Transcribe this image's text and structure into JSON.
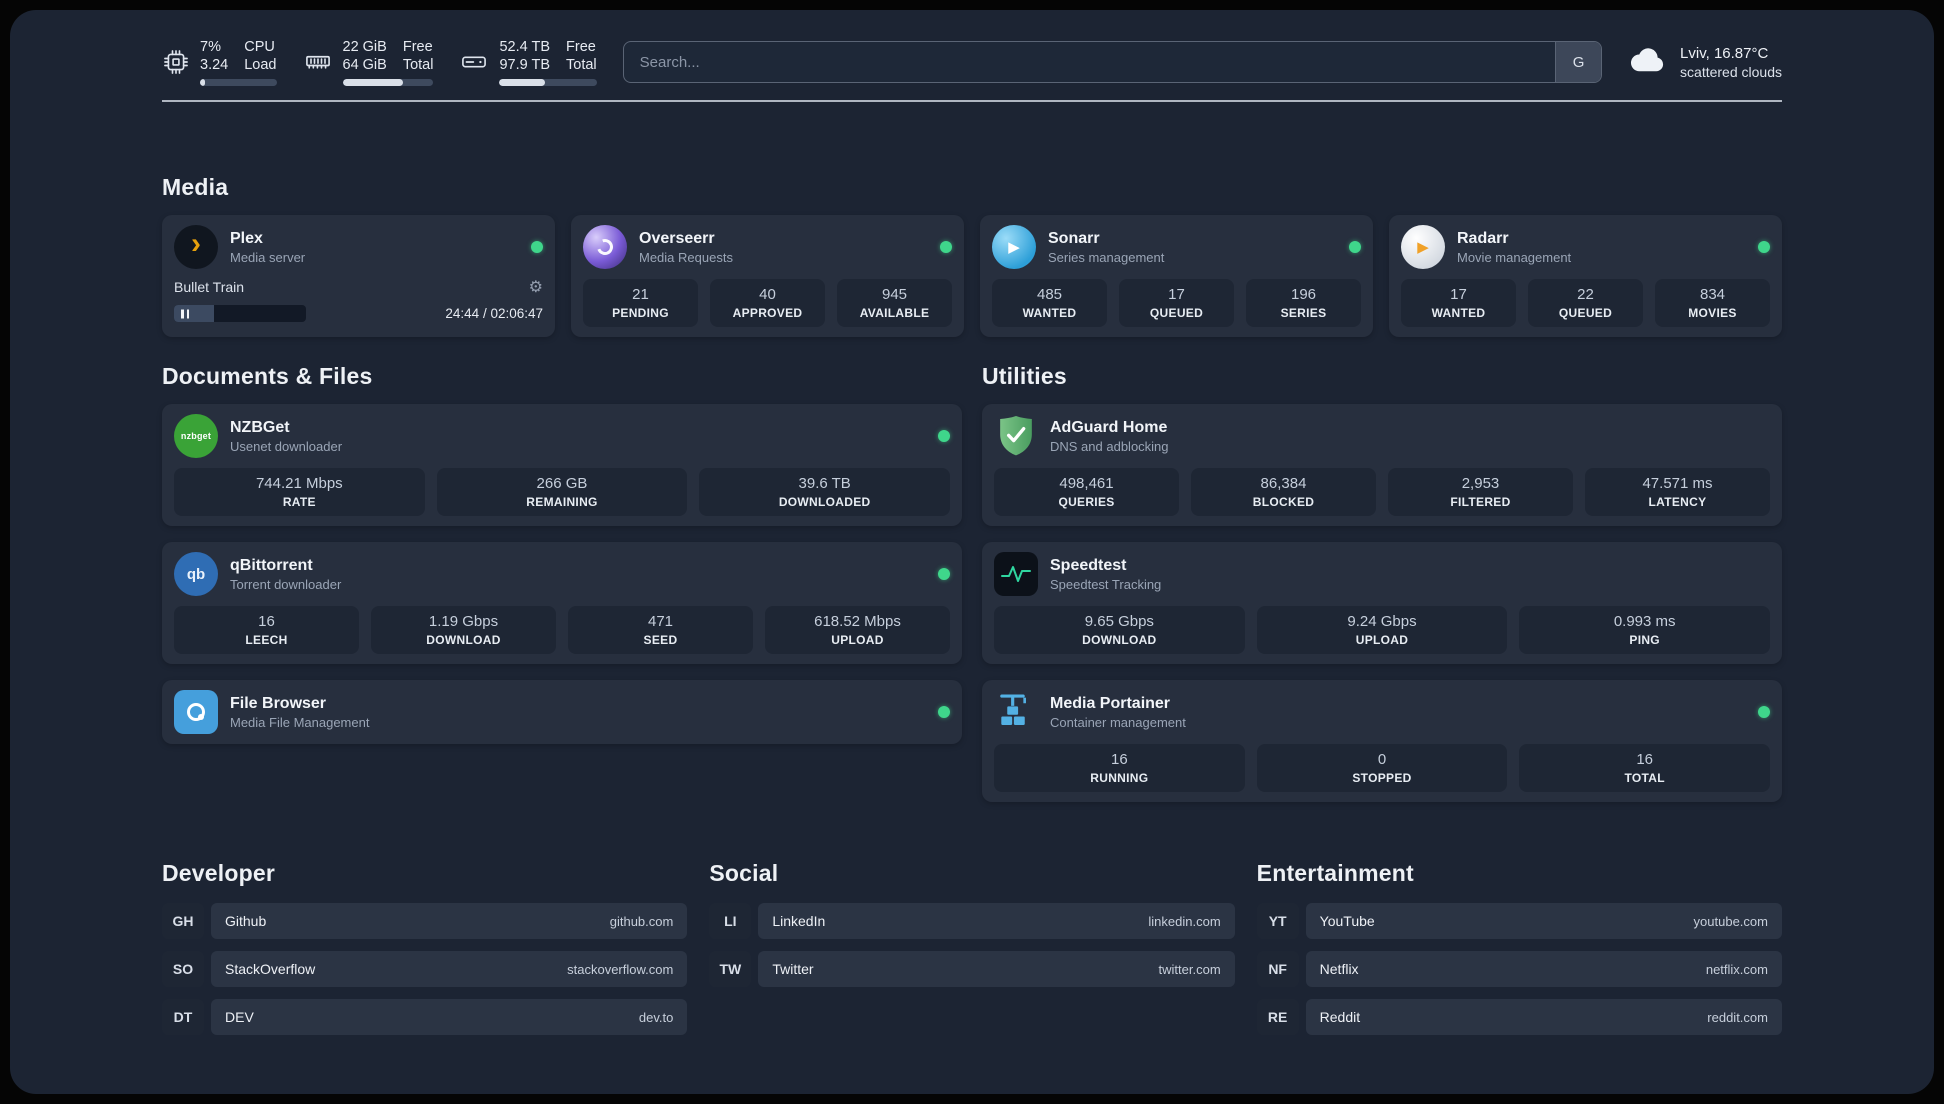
{
  "topbar": {
    "cpu": {
      "value_top": "7%",
      "value_bottom": "3.24",
      "label_top": "CPU",
      "label_bottom": "Load",
      "progress_pct": 7,
      "icon": "cpu-chip-icon"
    },
    "memory": {
      "value_top": "22 GiB",
      "value_bottom": "64 GiB",
      "label_top": "Free",
      "label_bottom": "Total",
      "progress_pct": 66,
      "icon": "memory-icon"
    },
    "disk": {
      "value_top": "52.4 TB",
      "value_bottom": "97.9 TB",
      "label_top": "Free",
      "label_bottom": "Total",
      "progress_pct": 47,
      "icon": "disk-icon"
    },
    "search": {
      "placeholder": "Search...",
      "provider_button": "G"
    },
    "weather": {
      "location": "Lviv, 16.87°C",
      "condition": "scattered clouds",
      "icon": "cloud-icon"
    }
  },
  "colors": {
    "status_online": "#3fd68b",
    "panel_bg": "#1c2433",
    "card_bg": "#272f3e",
    "tile_bg": "#1e2634"
  },
  "sections": {
    "media": {
      "title": "Media",
      "services": {
        "plex": {
          "name": "Plex",
          "desc": "Media server",
          "status": "online",
          "icon": "plex-icon",
          "now_playing": {
            "title": "Bullet Train",
            "time": "24:44 / 02:06:47",
            "progress_pct": 30
          }
        },
        "overseerr": {
          "name": "Overseerr",
          "desc": "Media Requests",
          "status": "online",
          "icon": "overseerr-icon",
          "stats": [
            {
              "value": "21",
              "label": "PENDING"
            },
            {
              "value": "40",
              "label": "APPROVED"
            },
            {
              "value": "945",
              "label": "AVAILABLE"
            }
          ]
        },
        "sonarr": {
          "name": "Sonarr",
          "desc": "Series management",
          "status": "online",
          "icon": "sonarr-icon",
          "stats": [
            {
              "value": "485",
              "label": "WANTED"
            },
            {
              "value": "17",
              "label": "QUEUED"
            },
            {
              "value": "196",
              "label": "SERIES"
            }
          ]
        },
        "radarr": {
          "name": "Radarr",
          "desc": "Movie management",
          "status": "online",
          "icon": "radarr-icon",
          "stats": [
            {
              "value": "17",
              "label": "WANTED"
            },
            {
              "value": "22",
              "label": "QUEUED"
            },
            {
              "value": "834",
              "label": "MOVIES"
            }
          ]
        }
      }
    },
    "documents": {
      "title": "Documents & Files",
      "services": {
        "nzbget": {
          "name": "NZBGet",
          "desc": "Usenet downloader",
          "status": "online",
          "icon": "nzbget-icon",
          "icon_text": "nzbget",
          "stats": [
            {
              "value": "744.21 Mbps",
              "label": "RATE"
            },
            {
              "value": "266 GB",
              "label": "REMAINING"
            },
            {
              "value": "39.6 TB",
              "label": "DOWNLOADED"
            }
          ]
        },
        "qbittorrent": {
          "name": "qBittorrent",
          "desc": "Torrent downloader",
          "status": "online",
          "icon": "qbittorrent-icon",
          "icon_text": "qb",
          "stats": [
            {
              "value": "16",
              "label": "LEECH"
            },
            {
              "value": "1.19 Gbps",
              "label": "DOWNLOAD"
            },
            {
              "value": "471",
              "label": "SEED"
            },
            {
              "value": "618.52 Mbps",
              "label": "UPLOAD"
            }
          ]
        },
        "filebrowser": {
          "name": "File Browser",
          "desc": "Media File Management",
          "status": "online",
          "icon": "filebrowser-icon"
        }
      }
    },
    "utilities": {
      "title": "Utilities",
      "services": {
        "adguard": {
          "name": "AdGuard Home",
          "desc": "DNS and adblocking",
          "icon": "adguard-shield-icon",
          "stats": [
            {
              "value": "498,461",
              "label": "QUERIES"
            },
            {
              "value": "86,384",
              "label": "BLOCKED"
            },
            {
              "value": "2,953",
              "label": "FILTERED"
            },
            {
              "value": "47.571 ms",
              "label": "LATENCY"
            }
          ]
        },
        "speedtest": {
          "name": "Speedtest",
          "desc": "Speedtest Tracking",
          "icon": "speedtest-graph-icon",
          "stats": [
            {
              "value": "9.65 Gbps",
              "label": "DOWNLOAD"
            },
            {
              "value": "9.24 Gbps",
              "label": "UPLOAD"
            },
            {
              "value": "0.993 ms",
              "label": "PING"
            }
          ]
        },
        "portainer": {
          "name": "Media Portainer",
          "desc": "Container management",
          "status": "online",
          "icon": "portainer-crane-icon",
          "stats": [
            {
              "value": "16",
              "label": "RUNNING"
            },
            {
              "value": "0",
              "label": "STOPPED"
            },
            {
              "value": "16",
              "label": "TOTAL"
            }
          ]
        }
      }
    },
    "bookmarks": {
      "developer": {
        "title": "Developer",
        "items": [
          {
            "abbr": "GH",
            "name": "Github",
            "url": "github.com"
          },
          {
            "abbr": "SO",
            "name": "StackOverflow",
            "url": "stackoverflow.com"
          },
          {
            "abbr": "DT",
            "name": "DEV",
            "url": "dev.to"
          }
        ]
      },
      "social": {
        "title": "Social",
        "items": [
          {
            "abbr": "LI",
            "name": "LinkedIn",
            "url": "linkedin.com"
          },
          {
            "abbr": "TW",
            "name": "Twitter",
            "url": "twitter.com"
          }
        ]
      },
      "entertainment": {
        "title": "Entertainment",
        "items": [
          {
            "abbr": "YT",
            "name": "YouTube",
            "url": "youtube.com"
          },
          {
            "abbr": "NF",
            "name": "Netflix",
            "url": "netflix.com"
          },
          {
            "abbr": "RE",
            "name": "Reddit",
            "url": "reddit.com"
          }
        ]
      }
    }
  }
}
